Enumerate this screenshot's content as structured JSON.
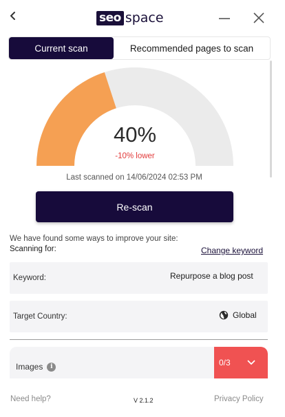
{
  "header": {
    "logo_highlight": "seo",
    "logo_text": "space",
    "back_icon": "chevron-left-icon",
    "minimize_icon": "minimize-icon",
    "close_icon": "close-icon"
  },
  "tabs": [
    {
      "label": "Current scan",
      "active": true
    },
    {
      "label": "Recommended pages to scan",
      "active": false
    }
  ],
  "score": {
    "value": "40%",
    "fraction": 0.4,
    "delta": "-10% lower",
    "last_scanned": "Last scanned on 14/06/2024 02:53 PM",
    "fill_color": "#f5a053",
    "track_color": "#ebebeb"
  },
  "rescan_label": "Re-scan",
  "improve_text": "We have found some ways to improve your site:",
  "scanning_for": "Scanning for:",
  "change_keyword": "Change keyword",
  "keyword": {
    "label": "Keyword:",
    "value": "Repurpose a blog post"
  },
  "country": {
    "label": "Target Country:",
    "value": "Global",
    "icon": "globe-icon"
  },
  "images": {
    "label": "Images",
    "count": "0/3",
    "status_color": "#f05252"
  },
  "footer": {
    "help": "Need help?",
    "version": "V 2.1.2",
    "privacy": "Privacy Policy"
  },
  "colors": {
    "brand_dark": "#170b3b",
    "alert_red": "#e23b3b"
  }
}
